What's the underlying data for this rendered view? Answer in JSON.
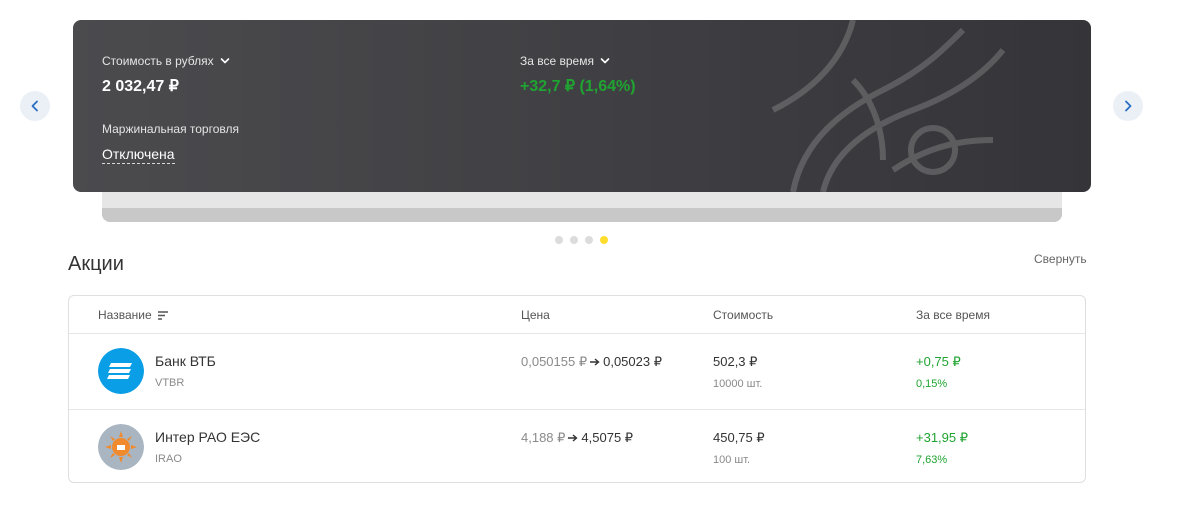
{
  "summary": {
    "value_label": "Стоимость в рублях",
    "value": "2 032,47 ₽",
    "period_label": "За все время",
    "period_change": "+32,7 ₽ (1,64%)",
    "margin_label": "Маржинальная торговля",
    "margin_value": "Отключена"
  },
  "carousel": {
    "slides": 4,
    "active_slide": 4
  },
  "section": {
    "title": "Акции",
    "collapse_label": "Свернуть"
  },
  "table": {
    "headers": {
      "name": "Название",
      "price": "Цена",
      "cost": "Стоимость",
      "change": "За все время"
    },
    "rows": [
      {
        "name": "Банк ВТБ",
        "ticker": "VTBR",
        "price_old": "0,050155 ₽",
        "price_new": "0,05023 ₽",
        "cost": "502,3 ₽",
        "qty": "10000 шт.",
        "change_abs": "+0,75 ₽",
        "change_pct": "0,15%"
      },
      {
        "name": "Интер РАО ЕЭС",
        "ticker": "IRAO",
        "price_old": "4,188 ₽",
        "price_new": "4,5075 ₽",
        "cost": "450,75 ₽",
        "qty": "100 шт.",
        "change_abs": "+31,95 ₽",
        "change_pct": "7,63%"
      }
    ]
  },
  "colors": {
    "positive": "#1fa431",
    "accent_dot": "#ffdd2d",
    "card_bg": "#414145",
    "vtb_logo": "#0a9ee6",
    "irao_logo_bg": "#a9b6c2",
    "irao_logo_accent": "#f08a2c"
  },
  "icons": {
    "prev": "chevron-left-icon",
    "next": "chevron-right-icon",
    "dropdown": "chevron-down-icon",
    "sort": "sort-icon",
    "arrow": "arrow-right-icon"
  }
}
